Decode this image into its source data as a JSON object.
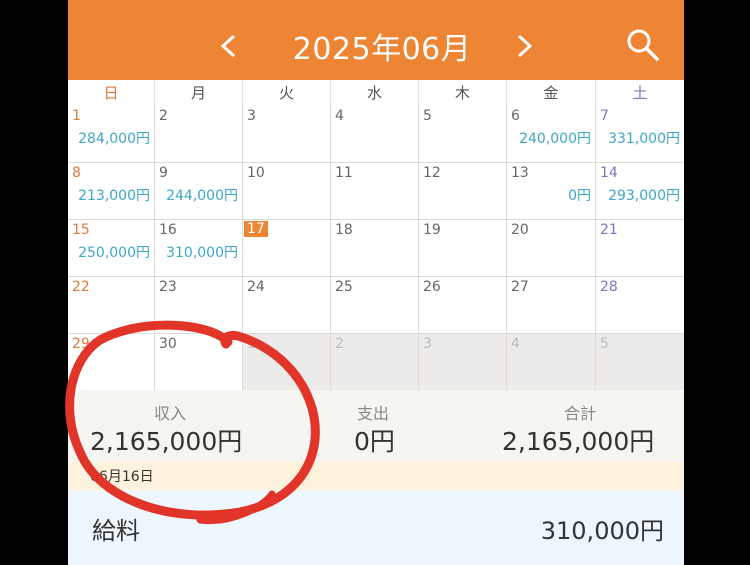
{
  "header": {
    "title": "2025年06月",
    "prev_icon": "chevron-left-icon",
    "next_icon": "chevron-right-icon",
    "search_icon": "search-icon"
  },
  "colors": {
    "accent": "#ee8534",
    "income": "#3ea6c7",
    "sunday": "#e07a3c",
    "saturday": "#7c74c4",
    "annotation": "#e2352a"
  },
  "weekdays": [
    "日",
    "月",
    "火",
    "水",
    "木",
    "金",
    "土"
  ],
  "weeks": [
    [
      {
        "day": "1",
        "amount": "284,000円"
      },
      {
        "day": "2"
      },
      {
        "day": "3"
      },
      {
        "day": "4"
      },
      {
        "day": "5"
      },
      {
        "day": "6",
        "amount": "240,000円"
      },
      {
        "day": "7",
        "amount": "331,000円"
      }
    ],
    [
      {
        "day": "8",
        "amount": "213,000円"
      },
      {
        "day": "9",
        "amount": "244,000円"
      },
      {
        "day": "10"
      },
      {
        "day": "11"
      },
      {
        "day": "12"
      },
      {
        "day": "13",
        "amount": "0円"
      },
      {
        "day": "14",
        "amount": "293,000円"
      }
    ],
    [
      {
        "day": "15",
        "amount": "250,000円"
      },
      {
        "day": "16",
        "amount": "310,000円"
      },
      {
        "day": "17",
        "today": true
      },
      {
        "day": "18"
      },
      {
        "day": "19"
      },
      {
        "day": "20"
      },
      {
        "day": "21"
      }
    ],
    [
      {
        "day": "22"
      },
      {
        "day": "23"
      },
      {
        "day": "24"
      },
      {
        "day": "25"
      },
      {
        "day": "26"
      },
      {
        "day": "27"
      },
      {
        "day": "28"
      }
    ],
    [
      {
        "day": "29"
      },
      {
        "day": "30"
      },
      {
        "day": "1",
        "outside": true
      },
      {
        "day": "2",
        "outside": true
      },
      {
        "day": "3",
        "outside": true
      },
      {
        "day": "4",
        "outside": true
      },
      {
        "day": "5",
        "outside": true
      }
    ]
  ],
  "summary": {
    "income_label": "収入",
    "income_value": "2,165,000円",
    "expense_label": "支出",
    "expense_value": "0円",
    "total_label": "合計",
    "total_value": "2,165,000円"
  },
  "selected_date": "06月16日",
  "entry": {
    "category": "給料",
    "amount": "310,000円"
  }
}
